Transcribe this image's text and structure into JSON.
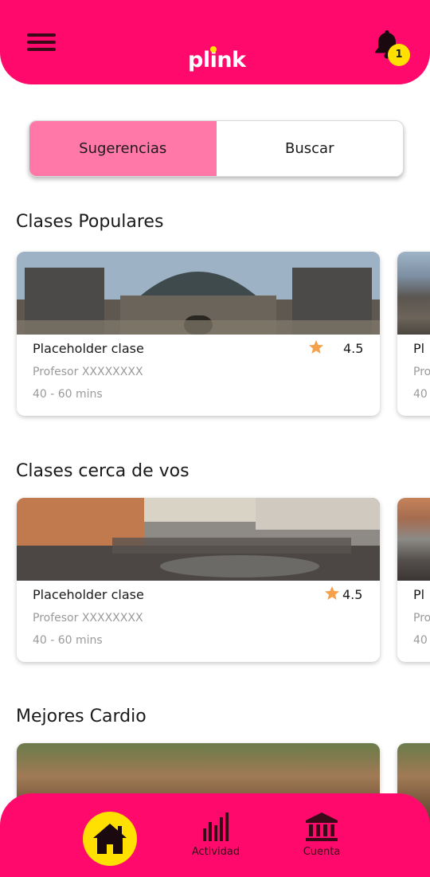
{
  "header": {
    "logo_text": "plink",
    "notification_count": "1",
    "colors": {
      "brand": "#ff0a6c",
      "accent": "#ffe000"
    }
  },
  "tabs": [
    {
      "label": "Sugerencias",
      "active": true
    },
    {
      "label": "Buscar",
      "active": false
    }
  ],
  "sections": [
    {
      "title": "Clases Populares",
      "card": {
        "title": "Placeholder clase",
        "teacher": "Profesor XXXXXXXX",
        "duration": "40 - 60 mins",
        "rating": "4.5"
      },
      "peek": {
        "title": "Pl",
        "teacher": "Pro",
        "duration": "40"
      }
    },
    {
      "title": "Clases cerca de vos",
      "card": {
        "title": "Placeholder clase",
        "teacher": "Profesor XXXXXXXX",
        "duration": "40 - 60 mins",
        "rating": "4.5"
      },
      "peek": {
        "title": "Pl",
        "teacher": "Pro",
        "duration": "40"
      }
    },
    {
      "title": "Mejores Cardio"
    }
  ],
  "bottom_nav": {
    "home_icon": "home-icon",
    "items": [
      {
        "label": "Actividad",
        "icon": "bar-chart-icon"
      },
      {
        "label": "Cuenta",
        "icon": "bank-icon"
      }
    ]
  }
}
